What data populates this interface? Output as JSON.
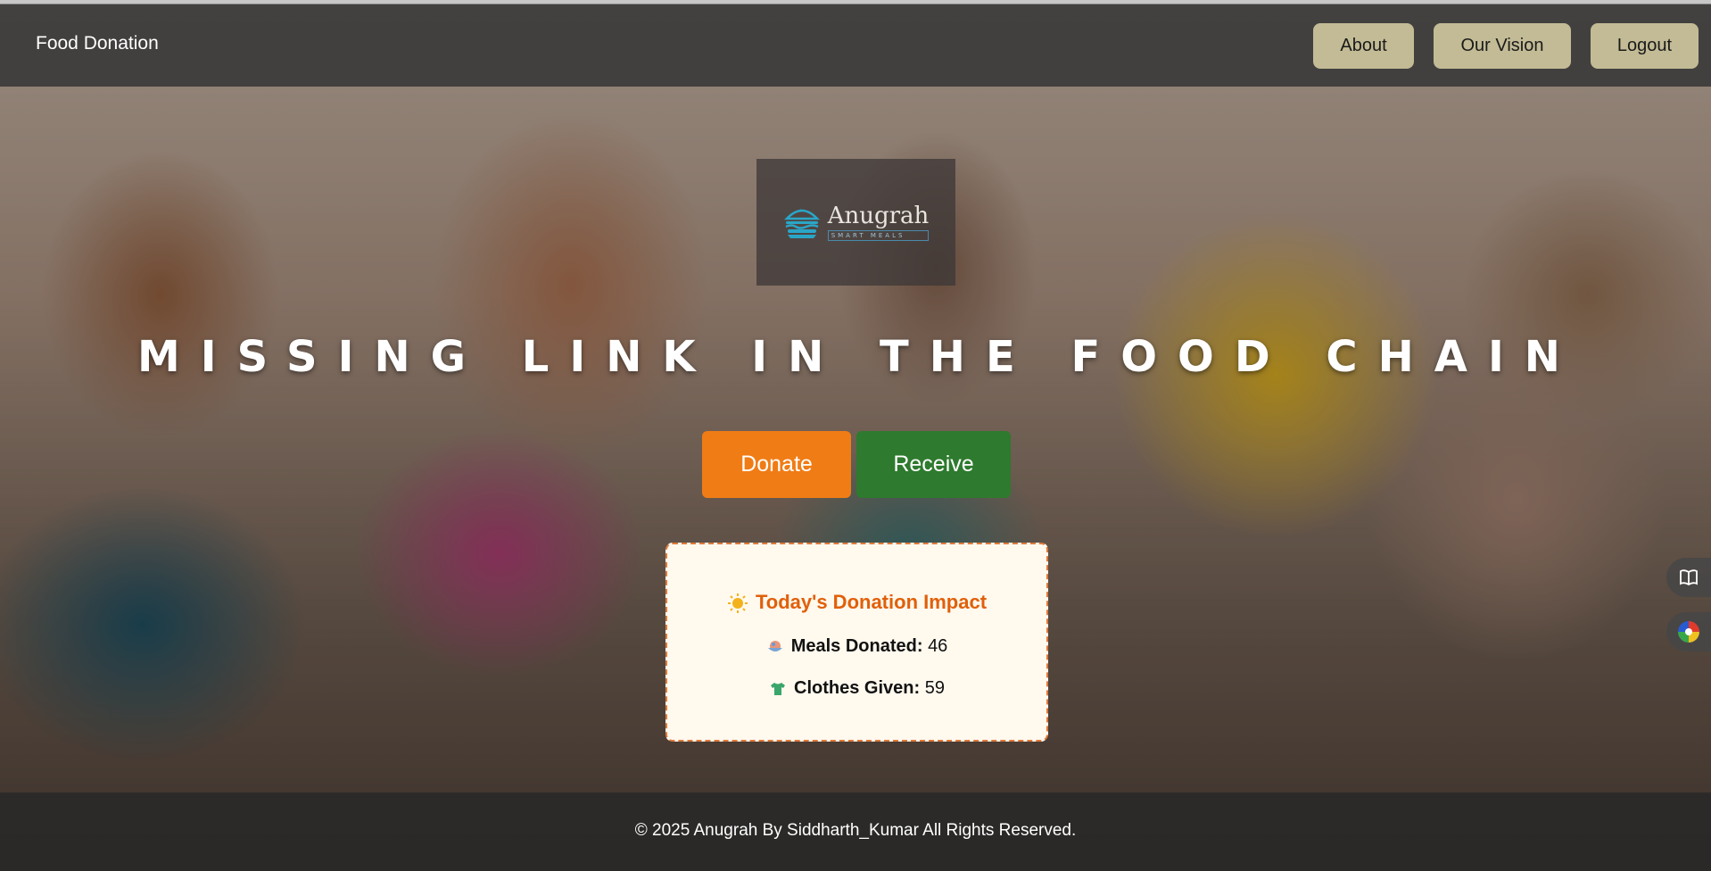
{
  "nav": {
    "brand": "Food Donation",
    "about": "About",
    "vision": "Our Vision",
    "logout": "Logout"
  },
  "logo": {
    "name": "Anugrah",
    "tagline": "SMART MEALS"
  },
  "hero": {
    "headline": "MISSING LINK IN THE FOOD CHAIN",
    "donate": "Donate",
    "receive": "Receive"
  },
  "impact": {
    "title": "Today's Donation Impact",
    "meals_label": "Meals Donated:",
    "meals_value": "46",
    "clothes_label": "Clothes Given:",
    "clothes_value": "59"
  },
  "footer": {
    "text": "© 2025 Anugrah By Siddharth_Kumar All Rights Reserved."
  },
  "colors": {
    "donate": "#f07c15",
    "receive": "#2e7a2e",
    "nav_button": "#c2bb95",
    "impact_title": "#e0600a"
  },
  "icons": [
    "sun-icon",
    "food-bowl-icon",
    "tshirt-icon",
    "book-icon",
    "palette-icon",
    "burger-logo-icon"
  ]
}
